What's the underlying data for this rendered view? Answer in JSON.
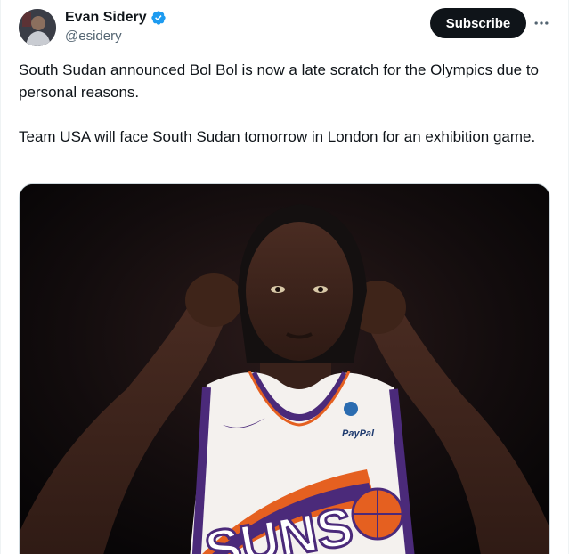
{
  "author": {
    "name": "Evan Sidery",
    "handle": "@esidery",
    "verified_icon": "verified-badge-icon"
  },
  "actions": {
    "subscribe_label": "Subscribe",
    "more_icon": "more-options-icon"
  },
  "tweet": {
    "paragraph_1": "South Sudan announced Bol Bol is now a late scratch for the Olympics due to personal reasons.",
    "paragraph_2": "Team USA will face South Sudan tomorrow in London for an exhibition game."
  },
  "media": {
    "jersey_brand": "PayPal",
    "jersey_text": "SUNS"
  },
  "colors": {
    "text": "#0f1419",
    "secondary": "#536471",
    "verified": "#1d9bf0",
    "button_bg": "#0f1419",
    "jersey_purple": "#4b2a7a",
    "jersey_orange": "#e56020"
  }
}
